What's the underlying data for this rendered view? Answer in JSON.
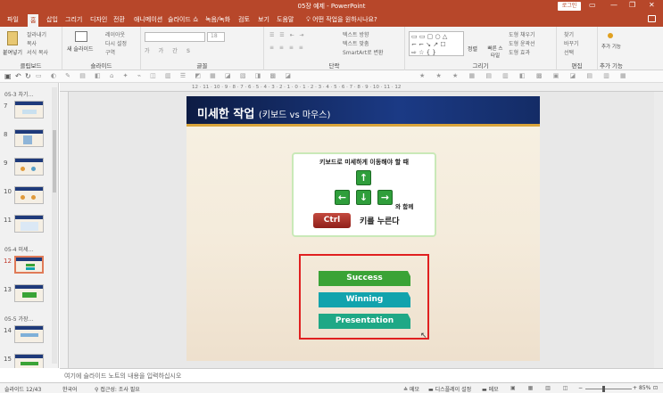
{
  "window": {
    "title": "05장 예제 - PowerPoint",
    "login": "로그인",
    "controls": [
      "▭",
      "—",
      "❐",
      "✕"
    ]
  },
  "tabs": [
    "파일",
    "홈",
    "삽입",
    "그리기",
    "디자인",
    "전환",
    "애니메이션",
    "슬라이드 쇼",
    "녹음/녹화",
    "검토",
    "보기",
    "도움말"
  ],
  "tell_me": "어떤 작업을 원하시나요?",
  "ribbon": {
    "clipboard": {
      "label": "클립보드",
      "paste": "붙여넣기",
      "cut": "잘라내기",
      "copy": "복사",
      "format": "서식 복사"
    },
    "slides": {
      "label": "슬라이드",
      "new_slide": "새 슬라이드",
      "layout": "레이아웃",
      "reset": "다시 설정",
      "section": "구역"
    },
    "font": {
      "label": "글꼴",
      "size": "18"
    },
    "paragraph": {
      "label": "단락",
      "text_direction": "텍스트 방향",
      "align_text": "텍스트 맞춤",
      "smartart": "SmartArt로 변환"
    },
    "drawing": {
      "label": "그리기",
      "arrange": "정렬",
      "quick_styles": "빠른 스타일",
      "fill": "도형 채우기",
      "outline": "도형 윤곽선",
      "effects": "도형 효과"
    },
    "editing": {
      "label": "편집",
      "find": "찾기",
      "replace": "바꾸기",
      "select": "선택"
    },
    "addins": {
      "label": "추가 기능",
      "btn": "추가 기능"
    }
  },
  "ruler_text": "12 · 11 · 10 · 9 · 8 · 7 · 6 · 5 · 4 · 3 · 2 · 1 · 0 · 1 · 2 · 3 · 4 · 5 · 6 · 7 · 8 · 9 · 10 · 11 · 12",
  "sections": [
    "05-3 차기...",
    "05-4 미세...",
    "05-5 가장..."
  ],
  "slides": [
    "7",
    "8",
    "9",
    "10",
    "11",
    "12",
    "13",
    "14",
    "15"
  ],
  "slide": {
    "title_main": "미세한 작업",
    "title_sub": "(키보드 vs 마우스)",
    "key_caption": "키보드로 미세하게 이동해야 할 때",
    "with_text": "와 함께",
    "ctrl_key": "Ctrl",
    "ctrl_text": "키를 누른다",
    "arrows": {
      "up": "↑",
      "left": "←",
      "down": "↓",
      "right": "→"
    },
    "bars": [
      {
        "label": "Success",
        "color": "#3aa336"
      },
      {
        "label": "Winning",
        "color": "#12a3ad"
      },
      {
        "label": "Presentation",
        "color": "#1fa886"
      }
    ]
  },
  "notes_placeholder": "여기에 슬라이드 노트의 내용을 입력하십시오",
  "status": {
    "slide_pos": "슬라이드 12/43",
    "language": "한국어",
    "accessibility": "접근성: 조사 필요",
    "notes": "메모",
    "display": "디스플레이 설정",
    "comments": "메모",
    "zoom": "85%"
  }
}
